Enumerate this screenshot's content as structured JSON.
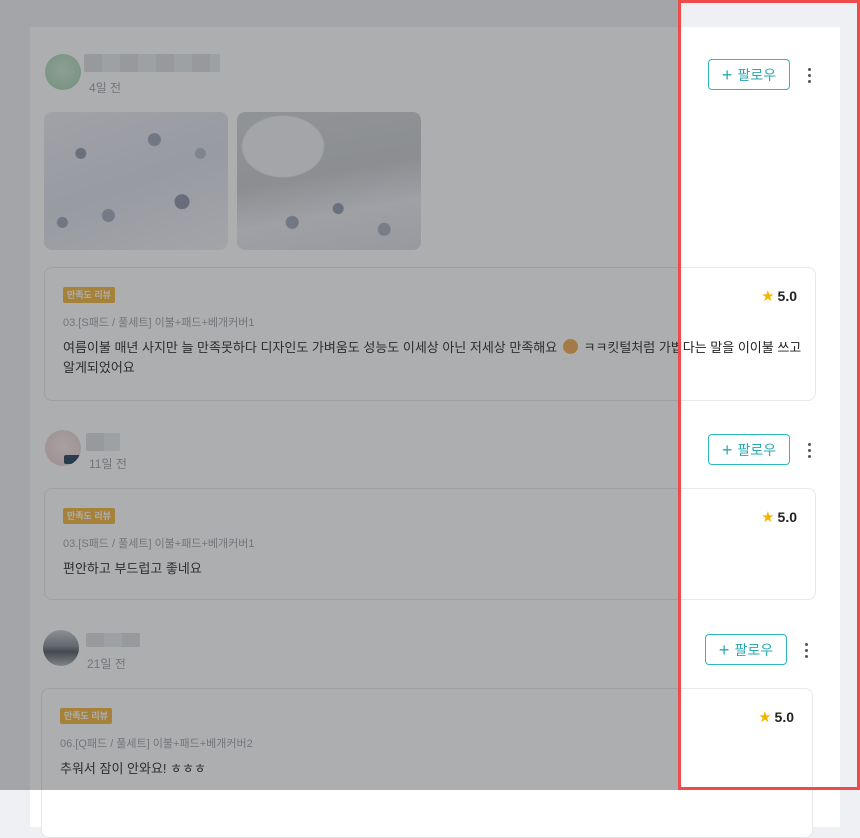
{
  "reviews": [
    {
      "days": "4일 전",
      "follow_label": "팔로우",
      "satisfaction_badge": "만족도 리뷰",
      "rating": "5.0",
      "option": "03.[S패드 / 풀세트] 이불+패드+베개커버1",
      "text_before_emoji": "여름이불 매년 사지만 늘 만족못하다 디자인도 가벼움도 성능도 이세상 아닌 저세상 만족해요",
      "text_after_emoji": "ㅋㅋ킷털처럼 가볍다는 말을 이이불 쓰고 알게되었어요",
      "photos": [
        "floral-bedding-photo",
        "bed-with-floral-duvet-photo"
      ]
    },
    {
      "days": "11일 전",
      "follow_label": "팔로우",
      "satisfaction_badge": "만족도 리뷰",
      "rating": "5.0",
      "option": "03.[S패드 / 풀세트] 이불+패드+베개커버1",
      "text": "편안하고 부드럽고 좋네요"
    },
    {
      "days": "21일 전",
      "follow_label": "팔로우",
      "satisfaction_badge": "만족도 리뷰",
      "rating": "5.0",
      "option": "06.[Q패드 / 풀세트] 이불+패드+베개커버2",
      "text": "추워서 잠이 안와요! ㅎㅎㅎ"
    }
  ],
  "icons": {
    "follow": "plus-icon",
    "more": "more-vertical-icon",
    "rating": "star-icon",
    "emoji": "grinning-face-emoji"
  },
  "colors": {
    "accent": "#2cb8bf",
    "badge": "#f2b233",
    "star": "#f5b400",
    "highlight_border": "#ef4b4b",
    "overlay": "rgba(60,62,66,0.42)"
  }
}
